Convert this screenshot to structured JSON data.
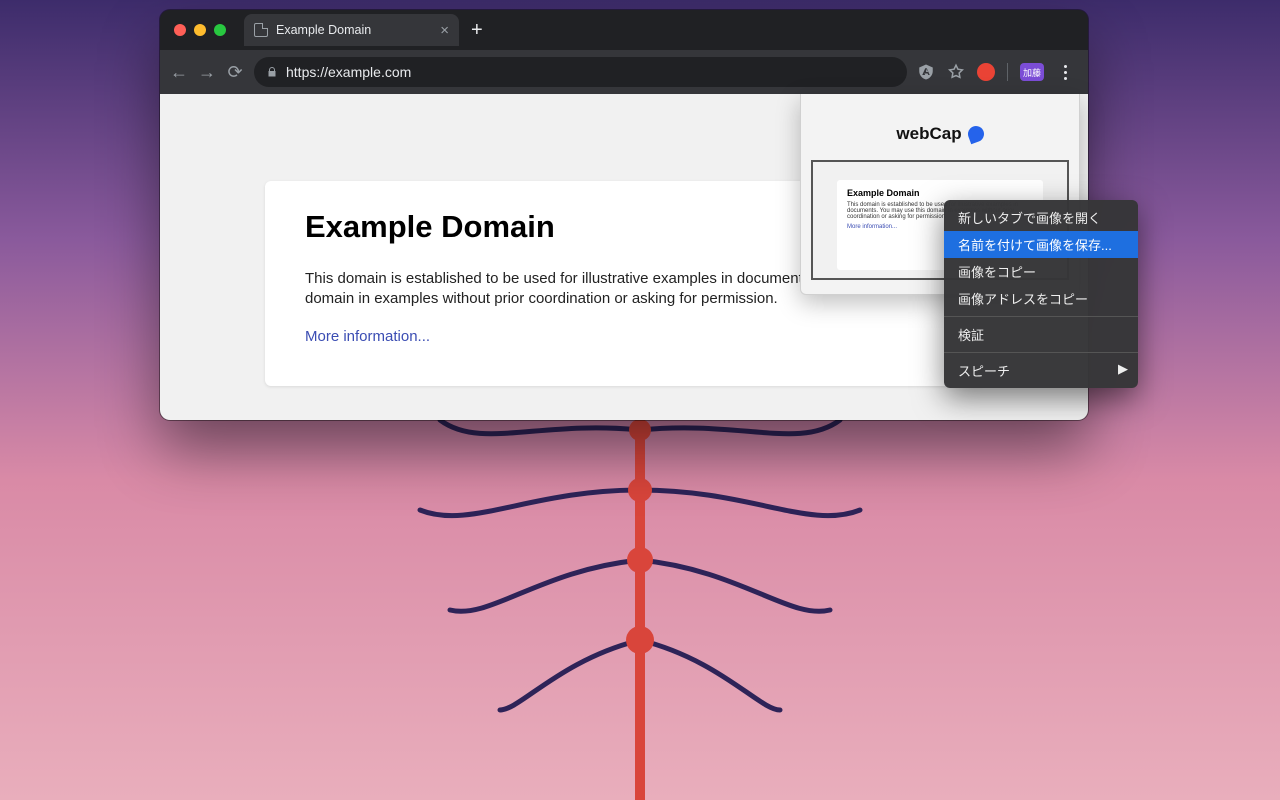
{
  "browser": {
    "tab_title": "Example Domain",
    "url": "https://example.com",
    "avatar_label": "加藤"
  },
  "page": {
    "heading": "Example Domain",
    "paragraph": "This domain is established to be used for illustrative examples in documents. You may use this domain in examples without prior coordination or asking for permission.",
    "link_text": "More information..."
  },
  "popup": {
    "title": "webCap",
    "thumb_heading": "Example Domain",
    "thumb_body": "This domain is established to be used for illustrative examples in documents. You may use this domain in examples without prior coordination or asking for permission.",
    "thumb_link": "More information..."
  },
  "context_menu": {
    "items": [
      "新しいタブで画像を開く",
      "名前を付けて画像を保存...",
      "画像をコピー",
      "画像アドレスをコピー"
    ],
    "inspect": "検証",
    "speech": "スピーチ"
  }
}
